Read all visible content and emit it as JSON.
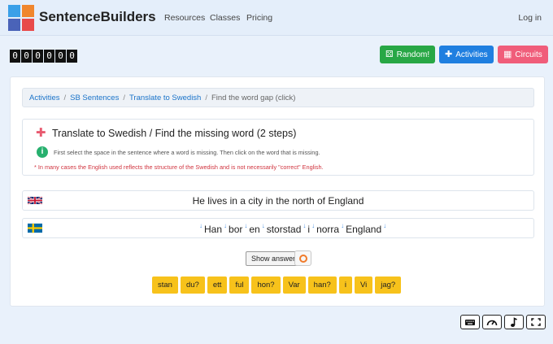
{
  "navbar": {
    "brand": "SentenceBuilders",
    "links": [
      "Resources",
      "Classes",
      "Pricing"
    ],
    "login": "Log in",
    "logo_colors": [
      "#3aa0e8",
      "#f0862d",
      "#4a63b8",
      "#e84a4a"
    ]
  },
  "counter": {
    "digits": [
      "0",
      "0",
      "0",
      "0",
      "0",
      "0"
    ]
  },
  "top_buttons": {
    "random": {
      "label": "Random!",
      "color": "#28a745",
      "icon": "dice-icon"
    },
    "activities": {
      "label": "Activities",
      "color": "#1f7fe0",
      "icon": "puzzle-icon"
    },
    "circuits": {
      "label": "Circuits",
      "color": "#f05d7a",
      "icon": "grid-icon"
    }
  },
  "breadcrumb": {
    "items": [
      "Activities",
      "SB Sentences",
      "Translate to Swedish"
    ],
    "current": "Find the word gap (click)"
  },
  "task": {
    "title": "Translate to Swedish / Find the missing word (2 steps)",
    "instruction": "First select the space in the sentence where a word is missing. Then click on the word that is missing.",
    "note": "* In many cases the English used reflects the structure of the Swedish and is not necessarily \"correct\" English."
  },
  "sentences": {
    "english": "He lives in a city in the north of England",
    "swedish_words": [
      "Han",
      "bor",
      "en",
      "storstad",
      "i",
      "norra",
      "England"
    ]
  },
  "controls": {
    "show_answer": "Show answer"
  },
  "word_bank": [
    "stan",
    "du?",
    "ett",
    "ful",
    "hon?",
    "Var",
    "han?",
    "i",
    "Vi",
    "jag?"
  ],
  "tools": [
    "keyboard-icon",
    "speedometer-icon",
    "music-note-icon",
    "fullscreen-icon"
  ]
}
